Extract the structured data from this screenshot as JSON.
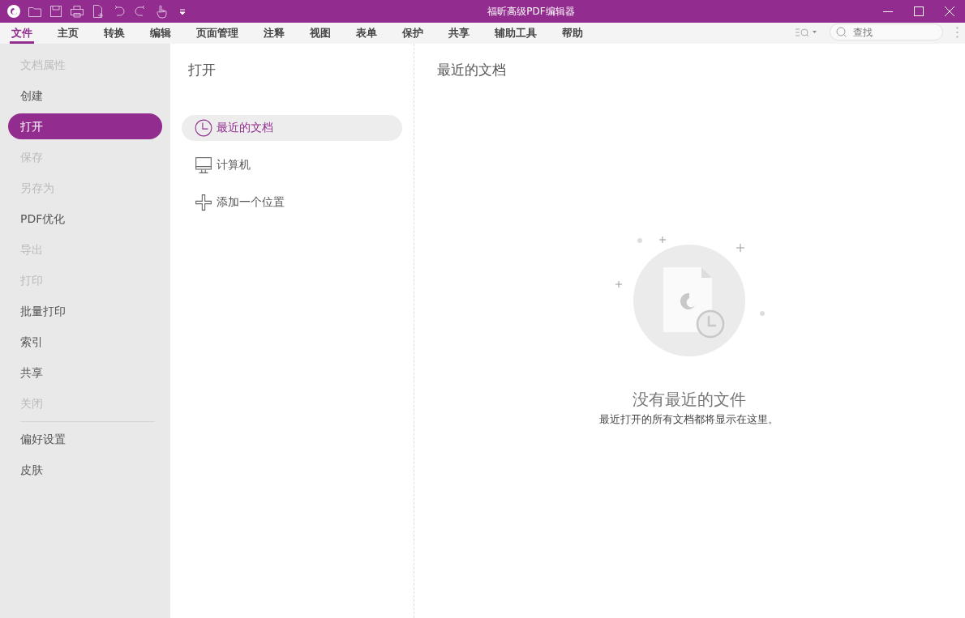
{
  "window": {
    "title": "福昕高级PDF编辑器"
  },
  "menu_tabs": [
    {
      "label": "文件",
      "selected": true
    },
    {
      "label": "主页",
      "selected": false
    },
    {
      "label": "转换",
      "selected": false
    },
    {
      "label": "编辑",
      "selected": false
    },
    {
      "label": "页面管理",
      "selected": false
    },
    {
      "label": "注释",
      "selected": false
    },
    {
      "label": "视图",
      "selected": false
    },
    {
      "label": "表单",
      "selected": false
    },
    {
      "label": "保护",
      "selected": false
    },
    {
      "label": "共享",
      "selected": false
    },
    {
      "label": "辅助工具",
      "selected": false
    },
    {
      "label": "帮助",
      "selected": false
    }
  ],
  "search": {
    "placeholder": "查找"
  },
  "sidebar": {
    "items": [
      {
        "label": "文档属性",
        "disabled": true,
        "selected": false
      },
      {
        "label": "创建",
        "disabled": false,
        "selected": false
      },
      {
        "label": "打开",
        "disabled": false,
        "selected": true
      },
      {
        "label": "保存",
        "disabled": true,
        "selected": false
      },
      {
        "label": "另存为",
        "disabled": true,
        "selected": false
      },
      {
        "label": "PDF优化",
        "disabled": false,
        "selected": false
      },
      {
        "label": "导出",
        "disabled": true,
        "selected": false
      },
      {
        "label": "打印",
        "disabled": true,
        "selected": false
      },
      {
        "label": "批量打印",
        "disabled": false,
        "selected": false
      },
      {
        "label": "索引",
        "disabled": false,
        "selected": false
      },
      {
        "label": "共享",
        "disabled": false,
        "selected": false
      },
      {
        "label": "关闭",
        "disabled": true,
        "selected": false
      }
    ],
    "bottom_items": [
      {
        "label": "偏好设置",
        "disabled": false,
        "selected": false
      },
      {
        "label": "皮肤",
        "disabled": false,
        "selected": false
      }
    ]
  },
  "open_panel": {
    "title": "打开",
    "locations": [
      {
        "label": "最近的文档",
        "kind": "clock",
        "selected": true
      },
      {
        "label": "计算机",
        "kind": "computer",
        "selected": false
      },
      {
        "label": "添加一个位置",
        "kind": "add",
        "selected": false
      }
    ]
  },
  "recent_panel": {
    "title": "最近的文档",
    "empty_title": "没有最近的文件",
    "empty_message": "最近打开的所有文档都将显示在这里。"
  }
}
